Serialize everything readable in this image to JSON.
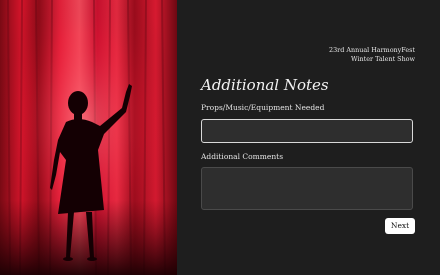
{
  "event": {
    "line1": "23rd Annual HarmonyFest",
    "line2": "Winter Talent Show"
  },
  "form": {
    "title": "Additional Notes",
    "field1_label": "Props/Music/Equipment Needed",
    "field1_value": "",
    "field2_label": "Additional Comments",
    "field2_value": "",
    "next_label": "Next"
  },
  "image": {
    "subject": "silhouette of a performer before a red stage curtain"
  },
  "colors": {
    "curtain": "#c8102e",
    "background": "#1e1e1e",
    "button": "#ffffff"
  }
}
